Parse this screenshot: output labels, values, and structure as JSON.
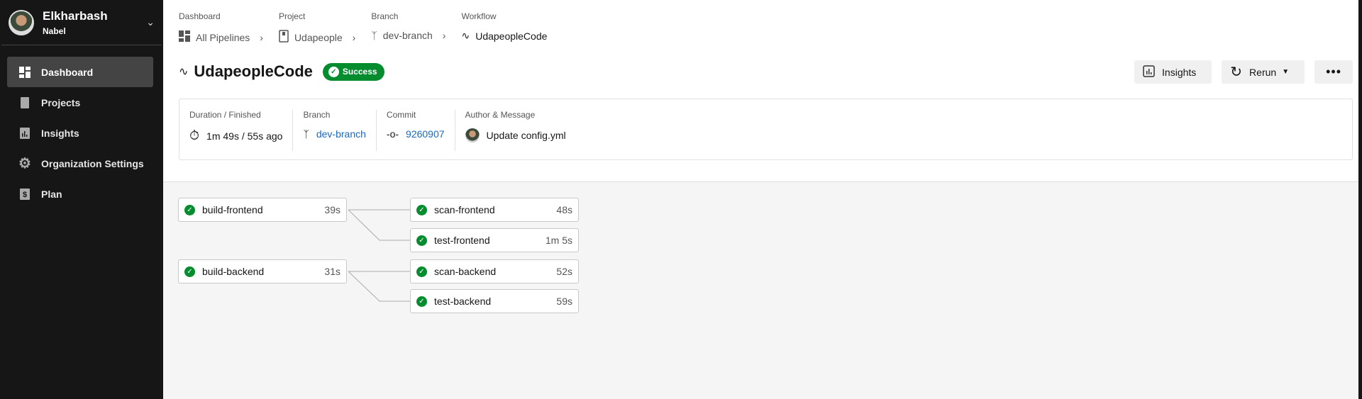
{
  "user": {
    "first": "Elkharbash",
    "last": "Nabel"
  },
  "nav": [
    {
      "label": "Dashboard",
      "icon": "dashboard-icon"
    },
    {
      "label": "Projects",
      "icon": "project-icon"
    },
    {
      "label": "Insights",
      "icon": "insights-icon"
    },
    {
      "label": "Organization Settings",
      "icon": "gear-icon"
    },
    {
      "label": "Plan",
      "icon": "dollar-icon"
    }
  ],
  "breadcrumbs": [
    {
      "label": "Dashboard",
      "value": "All Pipelines"
    },
    {
      "label": "Project",
      "value": "Udapeople"
    },
    {
      "label": "Branch",
      "value": "dev-branch"
    },
    {
      "label": "Workflow",
      "value": "UdapeopleCode"
    }
  ],
  "workflow": {
    "title": "UdapeopleCode",
    "status": "Success",
    "status_color": "#058c2e"
  },
  "actions": {
    "insights": "Insights",
    "rerun": "Rerun",
    "more": "•••"
  },
  "info": {
    "duration_label": "Duration / Finished",
    "duration": "1m 49s / 55s ago",
    "branch_label": "Branch",
    "branch": "dev-branch",
    "commit_label": "Commit",
    "commit": "9260907",
    "author_label": "Author & Message",
    "message": "Update config.yml"
  },
  "jobs": [
    {
      "name": "build-frontend",
      "duration": "39s"
    },
    {
      "name": "scan-frontend",
      "duration": "48s"
    },
    {
      "name": "test-frontend",
      "duration": "1m 5s"
    },
    {
      "name": "build-backend",
      "duration": "31s"
    },
    {
      "name": "scan-backend",
      "duration": "52s"
    },
    {
      "name": "test-backend",
      "duration": "59s"
    }
  ]
}
